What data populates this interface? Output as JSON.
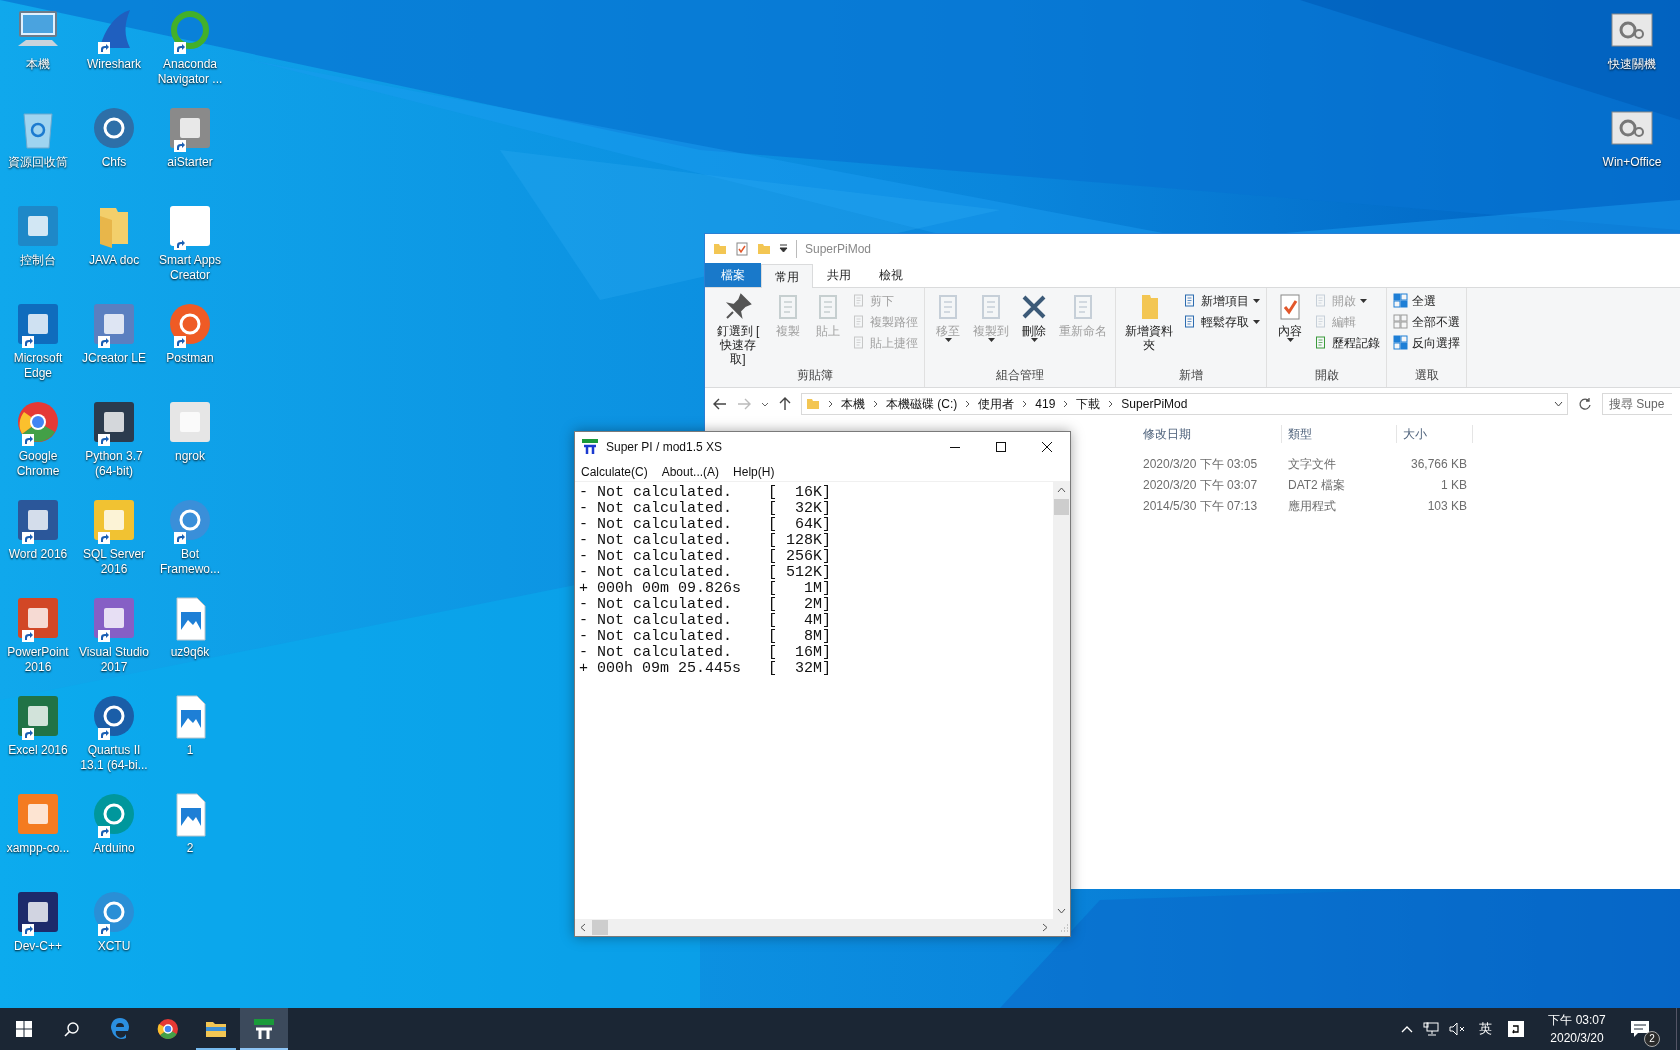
{
  "desktop": {
    "icons": [
      {
        "label": "本機",
        "shortcut": false
      },
      {
        "label": "資源回收筒",
        "shortcut": false
      },
      {
        "label": "控制台",
        "shortcut": false
      },
      {
        "label": "Microsoft Edge",
        "shortcut": true
      },
      {
        "label": "Google Chrome",
        "shortcut": true
      },
      {
        "label": "Word 2016",
        "shortcut": true
      },
      {
        "label": "PowerPoint 2016",
        "shortcut": true
      },
      {
        "label": "Excel 2016",
        "shortcut": true
      },
      {
        "label": "xampp-co...",
        "shortcut": false
      },
      {
        "label": "Dev-C++",
        "shortcut": true
      },
      {
        "label": "Wireshark",
        "shortcut": true
      },
      {
        "label": "Chfs",
        "shortcut": false
      },
      {
        "label": "JAVA doc",
        "shortcut": false
      },
      {
        "label": "JCreator LE",
        "shortcut": true
      },
      {
        "label": "Python 3.7 (64-bit)",
        "shortcut": true
      },
      {
        "label": "SQL Server 2016",
        "shortcut": true
      },
      {
        "label": "Visual Studio 2017",
        "shortcut": true
      },
      {
        "label": "Quartus II 13.1 (64-bi...",
        "shortcut": true
      },
      {
        "label": "Arduino",
        "shortcut": true
      },
      {
        "label": "XCTU",
        "shortcut": true
      },
      {
        "label": "Anaconda Navigator ...",
        "shortcut": true
      },
      {
        "label": "aiStarter",
        "shortcut": true
      },
      {
        "label": "Smart Apps Creator",
        "shortcut": true
      },
      {
        "label": "Postman",
        "shortcut": true
      },
      {
        "label": "ngrok",
        "shortcut": false
      },
      {
        "label": "Bot Framewo...",
        "shortcut": true
      },
      {
        "label": "uz9q6k",
        "shortcut": false
      },
      {
        "label": "1",
        "shortcut": false
      },
      {
        "label": "2",
        "shortcut": false
      }
    ],
    "right_icons": [
      {
        "label": "快速關機"
      },
      {
        "label": "Win+Office"
      }
    ]
  },
  "explorer": {
    "title": "SuperPiMod",
    "tabs": [
      {
        "label": "檔案",
        "kind": "file",
        "selected": false
      },
      {
        "label": "常用",
        "kind": "tab",
        "selected": true
      },
      {
        "label": "共用",
        "kind": "tab",
        "selected": false
      },
      {
        "label": "檢視",
        "kind": "tab",
        "selected": false
      }
    ],
    "ribbon": [
      {
        "label": "剪貼簿",
        "items": [
          {
            "kind": "large",
            "label": "釘選到 [ 快速存取]",
            "disabled": false,
            "dropdown": false
          },
          {
            "kind": "large",
            "label": "複製",
            "disabled": true,
            "dropdown": false
          },
          {
            "kind": "large",
            "label": "貼上",
            "disabled": true,
            "dropdown": false
          },
          {
            "kind": "small",
            "label": "剪下",
            "disabled": true,
            "dropdown": false
          },
          {
            "kind": "small",
            "label": "複製路徑",
            "disabled": true,
            "dropdown": false
          },
          {
            "kind": "small",
            "label": "貼上捷徑",
            "disabled": true,
            "dropdown": false
          }
        ]
      },
      {
        "label": "組合管理",
        "items": [
          {
            "kind": "large",
            "label": "移至",
            "disabled": true,
            "dropdown": true
          },
          {
            "kind": "large",
            "label": "複製到",
            "disabled": true,
            "dropdown": true
          },
          {
            "kind": "large",
            "label": "刪除",
            "disabled": false,
            "dropdown": true
          },
          {
            "kind": "large",
            "label": "重新命名",
            "disabled": true,
            "dropdown": false
          }
        ]
      },
      {
        "label": "新增",
        "items": [
          {
            "kind": "large",
            "label": "新增資料夾",
            "disabled": false,
            "dropdown": false
          },
          {
            "kind": "small",
            "label": "新增項目",
            "disabled": false,
            "dropdown": true
          },
          {
            "kind": "small",
            "label": "輕鬆存取",
            "disabled": false,
            "dropdown": true
          }
        ]
      },
      {
        "label": "開啟",
        "items": [
          {
            "kind": "large",
            "label": "內容",
            "disabled": false,
            "dropdown": true
          },
          {
            "kind": "small",
            "label": "開啟",
            "disabled": true,
            "dropdown": true
          },
          {
            "kind": "small",
            "label": "編輯",
            "disabled": true,
            "dropdown": false
          },
          {
            "kind": "small",
            "label": "歷程記錄",
            "disabled": false,
            "dropdown": false
          }
        ]
      },
      {
        "label": "選取",
        "items": [
          {
            "kind": "small",
            "label": "全選",
            "disabled": false,
            "dropdown": false
          },
          {
            "kind": "small",
            "label": "全部不選",
            "disabled": false,
            "dropdown": false
          },
          {
            "kind": "small",
            "label": "反向選擇",
            "disabled": false,
            "dropdown": false
          }
        ]
      }
    ],
    "path": [
      "本機",
      "本機磁碟 (C:)",
      "使用者",
      "419",
      "下載",
      "SuperPiMod"
    ],
    "search": {
      "placeholder": "搜尋 Supe"
    },
    "columns": [
      "修改日期",
      "類型",
      "大小"
    ],
    "rows": [
      [
        "2020/3/20 下午 03:05",
        "文字文件",
        "36,766 KB"
      ],
      [
        "2020/3/20 下午 03:07",
        "DAT2 檔案",
        "1 KB"
      ],
      [
        "2014/5/30 下午 07:13",
        "應用程式",
        "103 KB"
      ]
    ]
  },
  "superpi": {
    "title": "Super PI / mod1.5 XS",
    "menu": [
      "Calculate(C)",
      "About...(A)",
      "Help(H)"
    ],
    "lines": [
      "- Not calculated.    [  16K]",
      "- Not calculated.    [  32K]",
      "- Not calculated.    [  64K]",
      "- Not calculated.    [ 128K]",
      "- Not calculated.    [ 256K]",
      "- Not calculated.    [ 512K]",
      "+ 000h 00m 09.826s   [   1M]",
      "- Not calculated.    [   2M]",
      "- Not calculated.    [   4M]",
      "- Not calculated.    [   8M]",
      "- Not calculated.    [  16M]",
      "+ 000h 09m 25.445s   [  32M]"
    ]
  },
  "taskbar": {
    "apps": [
      {
        "open": false,
        "selected": false
      },
      {
        "open": false,
        "selected": false
      },
      {
        "open": true,
        "selected": false
      },
      {
        "open": true,
        "selected": true
      }
    ],
    "tray": {
      "ime": "英",
      "time": "下午 03:07",
      "date": "2020/3/20",
      "notifications": "2"
    }
  }
}
